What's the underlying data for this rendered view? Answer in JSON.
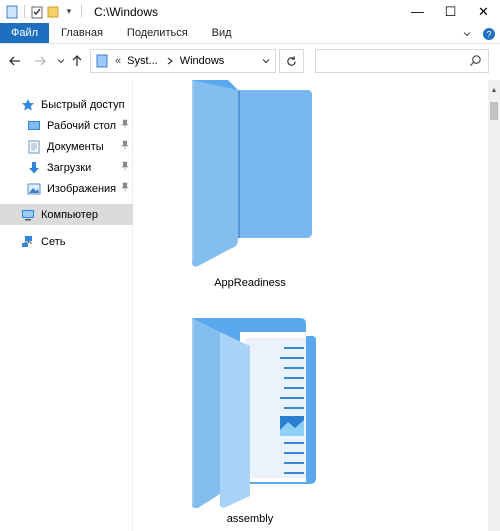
{
  "window": {
    "title": "C:\\Windows",
    "controls": {
      "minimize": "—",
      "maximize": "☐",
      "close": "✕"
    }
  },
  "ribbon": {
    "tabs": [
      {
        "label": "Файл"
      },
      {
        "label": "Главная"
      },
      {
        "label": "Поделиться"
      },
      {
        "label": "Вид"
      }
    ]
  },
  "address": {
    "overflow": "«",
    "crumbs": [
      "Syst...",
      "Windows"
    ],
    "search_placeholder": ""
  },
  "sidebar": {
    "quick_access": "Быстрый доступ",
    "items": [
      {
        "label": "Рабочий стол",
        "icon": "desktop-icon"
      },
      {
        "label": "Документы",
        "icon": "documents-icon"
      },
      {
        "label": "Загрузки",
        "icon": "downloads-icon"
      },
      {
        "label": "Изображения",
        "icon": "pictures-icon"
      }
    ],
    "computer": "Компьютер",
    "network": "Сеть"
  },
  "content": {
    "tiles": [
      {
        "label": "AppReadiness",
        "icon": "folder-icon"
      },
      {
        "label": "assembly",
        "icon": "folder-with-files-icon"
      }
    ]
  },
  "colors": {
    "accent": "#1f6fc1",
    "folder_front": "#7ab8f0",
    "folder_back": "#5ba7ee"
  }
}
